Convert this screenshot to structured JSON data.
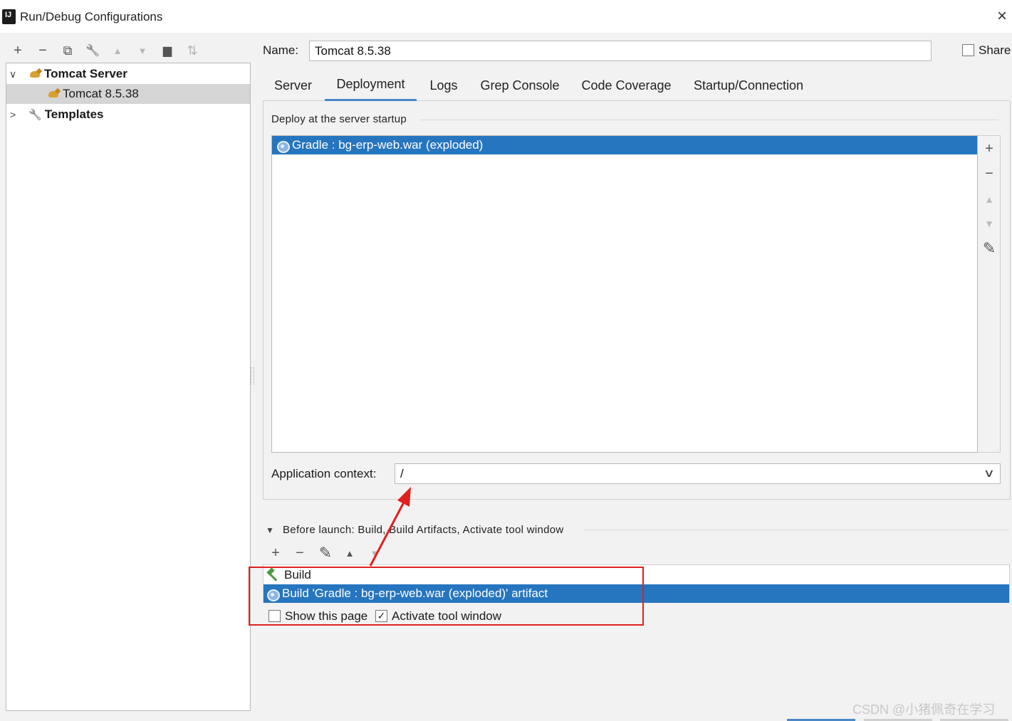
{
  "window": {
    "title": "Run/Debug Configurations",
    "close_glyph": "×"
  },
  "left_toolbar": {
    "icons": [
      "add-icon",
      "remove-icon",
      "copy-icon",
      "wrench-icon",
      "move-up-icon",
      "move-down-icon",
      "folder-icon",
      "sort-icon"
    ],
    "glyphs": {
      "add": "+",
      "remove": "−",
      "copy": "⧉",
      "wrench": "🔧",
      "up": "▲",
      "down": "▼",
      "folder": "▆",
      "sort": "⇅"
    }
  },
  "tree": {
    "items": [
      {
        "label": "Tomcat Server",
        "expanded": true,
        "arrow": "∨"
      },
      {
        "label": "Tomcat 8.5.38",
        "selected": true
      },
      {
        "label": "Templates",
        "expanded": false,
        "arrow": ">"
      }
    ]
  },
  "name": {
    "label": "Name:",
    "value": "Tomcat 8.5.38"
  },
  "share": {
    "label": "Share",
    "checked": false
  },
  "tabs": [
    {
      "label": "Server"
    },
    {
      "label": "Deployment",
      "active": true
    },
    {
      "label": "Logs"
    },
    {
      "label": "Grep Console"
    },
    {
      "label": "Code Coverage"
    },
    {
      "label": "Startup/Connection"
    }
  ],
  "deploy": {
    "section_title": "Deploy at the server startup",
    "items": [
      "Gradle : bg-erp-web.war (exploded)"
    ],
    "side_glyphs": {
      "add": "+",
      "remove": "−",
      "up": "▲",
      "down": "▼",
      "edit": "✎"
    }
  },
  "app_context": {
    "label": "Application context:",
    "value": "/",
    "chevron": "∨"
  },
  "before_launch": {
    "arrow": "▼",
    "label": "Before launch: Build, Build Artifacts, Activate tool window",
    "toolbar_glyphs": {
      "add": "+",
      "remove": "−",
      "edit": "✎",
      "up": "▲",
      "down": "▼"
    },
    "items": [
      {
        "label": "Build",
        "selected": false
      },
      {
        "label": "Build 'Gradle : bg-erp-web.war (exploded)' artifact",
        "selected": true
      }
    ]
  },
  "show_page": {
    "label": "Show this page",
    "checked": false
  },
  "activate_tool_window": {
    "label": "Activate tool window",
    "checked": true,
    "check_glyph": "✓"
  },
  "watermark": "CSDN @小猪佩奇在学习",
  "colors": {
    "selection": "#2675bf",
    "annotation_red": "#e02020",
    "tab_underline": "#4a88c7"
  }
}
